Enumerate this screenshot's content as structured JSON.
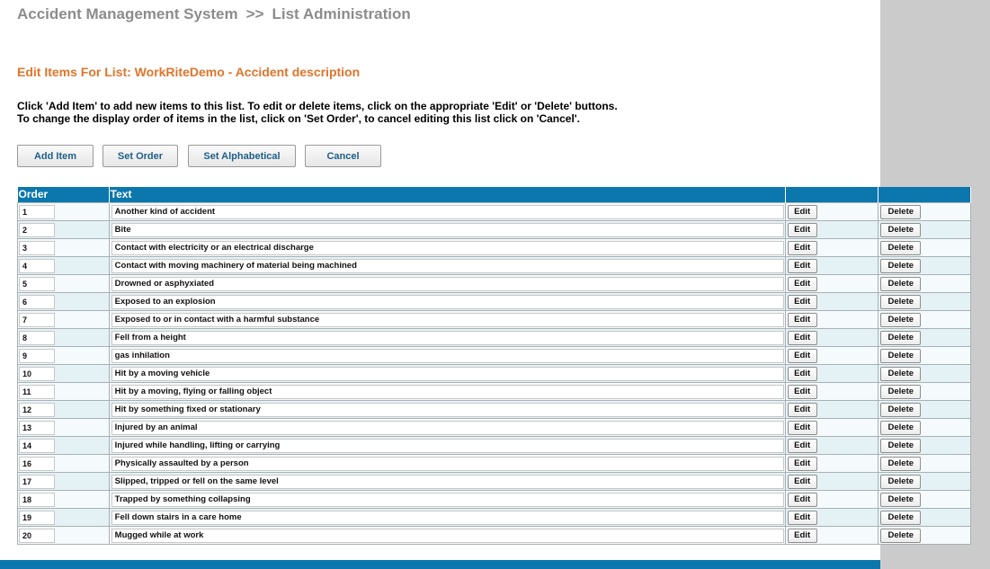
{
  "breadcrumb": {
    "app": "Accident Management System",
    "separator": ">>",
    "page": "List Administration"
  },
  "edit_title": "Edit Items For List: WorkRiteDemo - Accident description",
  "instructions": {
    "line1": "Click 'Add Item' to add new items to this list. To edit or delete items, click on the appropriate 'Edit' or 'Delete' buttons.",
    "line2": "To change the display order of items in the list, click on 'Set Order', to cancel editing this list click on 'Cancel'."
  },
  "buttons": {
    "add_item": "Add Item",
    "set_order": "Set Order",
    "set_alphabetical": "Set Alphabetical",
    "cancel": "Cancel"
  },
  "table": {
    "headers": {
      "order": "Order",
      "text": "Text",
      "edit": "",
      "delete": ""
    },
    "edit_label": "Edit",
    "delete_label": "Delete",
    "rows": [
      {
        "order": "1",
        "text": "Another kind of accident"
      },
      {
        "order": "2",
        "text": "Bite"
      },
      {
        "order": "3",
        "text": "Contact with electricity or an electrical discharge"
      },
      {
        "order": "4",
        "text": "Contact with moving machinery of material being machined"
      },
      {
        "order": "5",
        "text": "Drowned or asphyxiated"
      },
      {
        "order": "6",
        "text": "Exposed to an explosion"
      },
      {
        "order": "7",
        "text": "Exposed to or in contact with a harmful substance"
      },
      {
        "order": "8",
        "text": "Fell from a height"
      },
      {
        "order": "9",
        "text": "gas inhilation"
      },
      {
        "order": "10",
        "text": "Hit by a moving vehicle"
      },
      {
        "order": "11",
        "text": "Hit by a moving, flying or falling object"
      },
      {
        "order": "12",
        "text": "Hit by something fixed or stationary"
      },
      {
        "order": "13",
        "text": "Injured by an animal"
      },
      {
        "order": "14",
        "text": "Injured while handling, lifting or carrying"
      },
      {
        "order": "16",
        "text": "Physically assaulted by a person"
      },
      {
        "order": "17",
        "text": "Slipped, tripped or fell on the same level"
      },
      {
        "order": "18",
        "text": "Trapped by something collapsing"
      },
      {
        "order": "19",
        "text": "Fell down stairs in a care home"
      },
      {
        "order": "20",
        "text": "Mugged while at work"
      }
    ]
  },
  "colors": {
    "header_blue": "#0b77ad",
    "title_orange": "#e0752b",
    "breadcrumb_gray": "#8c8c8c",
    "side_panel": "#cbcbcb"
  }
}
